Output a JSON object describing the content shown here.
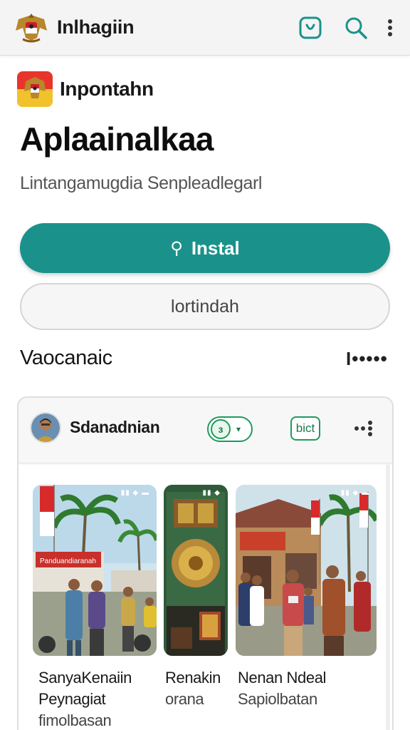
{
  "appbar": {
    "title": "Inlhagiin",
    "icons": [
      "emblem-logo",
      "store-icon",
      "search-icon",
      "more-vert-icon"
    ]
  },
  "app": {
    "publisher": "Inpontahn",
    "name": "Aplaainalkaa",
    "subtitle": "Lintangamugdia Senpleadlegarl",
    "install_label": "Instal",
    "secondary_label": "lortindah"
  },
  "section": {
    "title": "Vaocanaic",
    "more": "I•••••"
  },
  "card": {
    "author": "Sdanadnian",
    "toggle_glyph": "ɜ",
    "chip_label": "bict",
    "screens": [
      {
        "title": "SanyaKenaiin Peynagiat",
        "sub": "fimolbasan",
        "status": "▮▮ ◆ ▬"
      },
      {
        "title": "Renakin",
        "sub": "orana",
        "status": "▮▮ ◆"
      },
      {
        "title": "Nenan Ndeal",
        "sub": "Sapiolbatan",
        "status": "▮▮ ◆ ▬"
      }
    ],
    "banner_text": "Panduandiaranah"
  },
  "colors": {
    "accent": "#1a928b",
    "green": "#1e9a5c"
  }
}
